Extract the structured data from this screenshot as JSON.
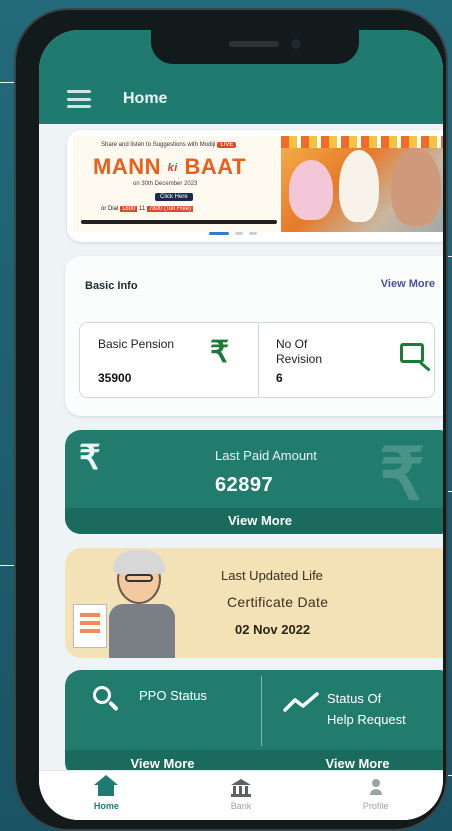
{
  "app": {
    "title": "Home"
  },
  "banner": {
    "tagline": "Share and listen to Suggestions with Modiji",
    "tag_chip": "LIVE",
    "headline_a": "MANN",
    "headline_ki": "ki",
    "headline_b": "BAAT",
    "date_line": "on 30th December 2023",
    "click_label": "Click Here",
    "dial_prefix": "or Dial",
    "dial_number": "1800",
    "dial_mid": "11",
    "dial_suffix": "7800 (Toll Free)",
    "active_slide": 1,
    "slide_count": 3
  },
  "basic_info": {
    "title": "Basic Info",
    "view_more": "View More",
    "basic_pension_label": "Basic Pension",
    "basic_pension_value": "35900",
    "revision_label": "No Of Revision",
    "revision_value": "6"
  },
  "last_paid": {
    "label": "Last Paid Amount",
    "value": "62897",
    "view_more": "View More",
    "icon": "rupee-icon"
  },
  "life_certificate": {
    "line1": "Last Updated Life",
    "line2": "Certificate Date",
    "date": "02 Nov 2022"
  },
  "actions": {
    "ppo_label": "PPO Status",
    "help_label_1": "Status Of",
    "help_label_2": "Help Request",
    "ppo_view_more": "View More",
    "help_view_more": "View More"
  },
  "bottom_nav": [
    {
      "label": "Home",
      "icon": "home-icon",
      "active": true
    },
    {
      "label": "Bank",
      "icon": "bank-icon",
      "active": false
    },
    {
      "label": "Profile",
      "icon": "profile-icon",
      "active": false
    }
  ],
  "colors": {
    "primary": "#1f7b70",
    "card_teal": "#227c6e",
    "life_card": "#f3e2b6",
    "link": "#4a4e9a",
    "rupee_green": "#1f7a3a"
  }
}
